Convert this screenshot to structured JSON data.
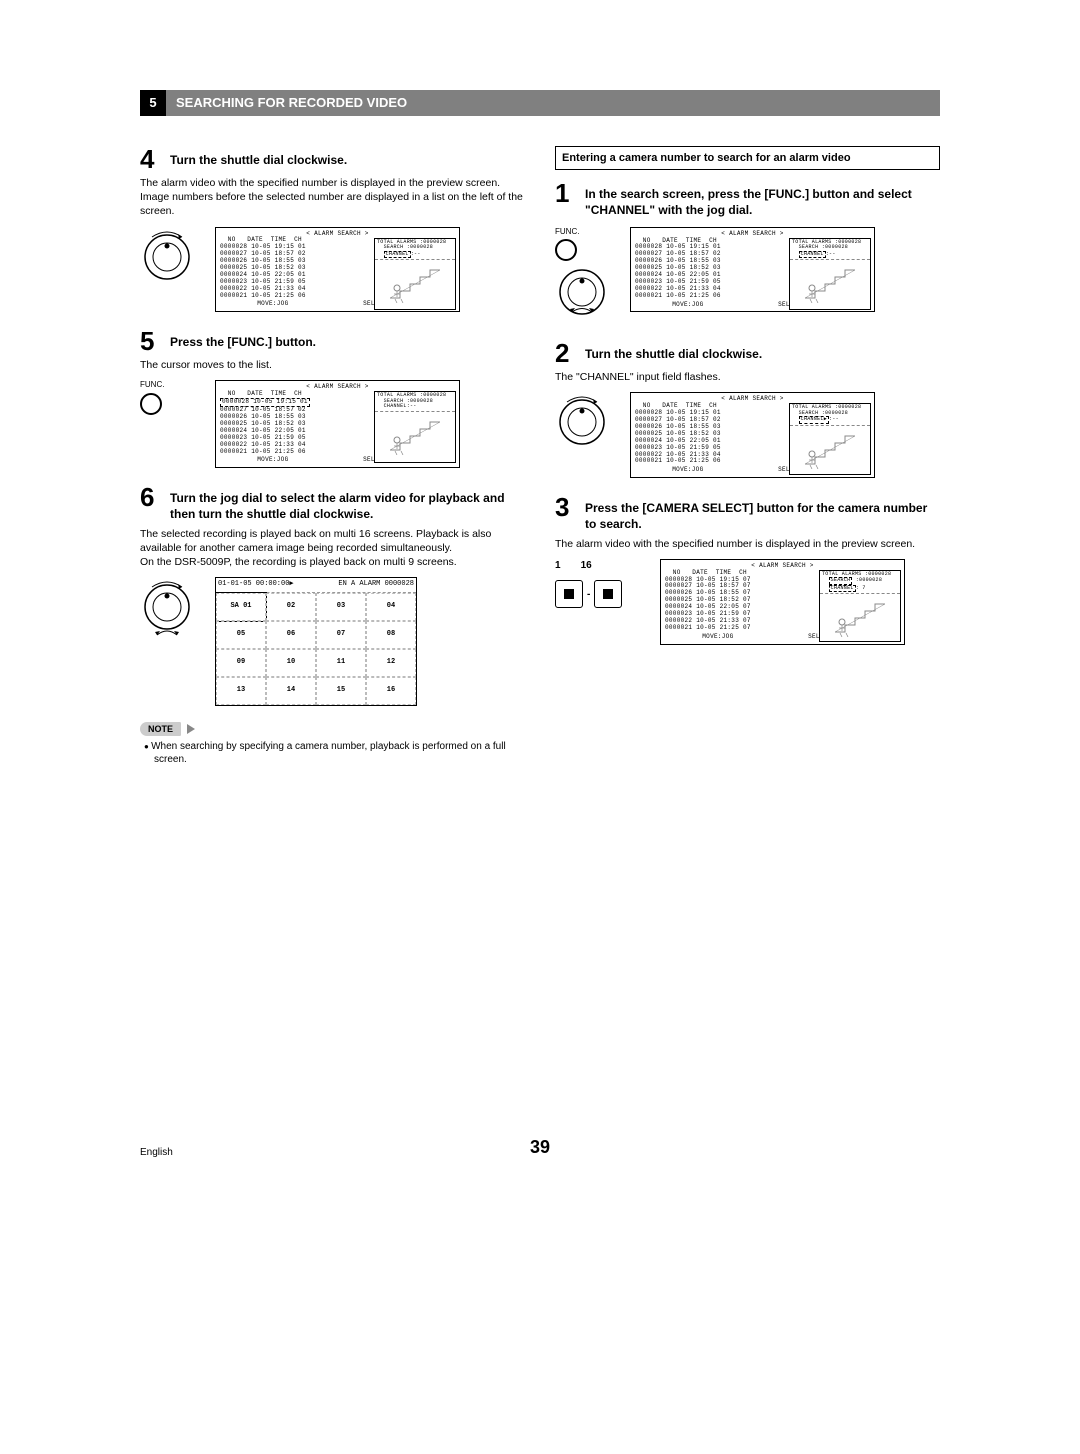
{
  "section": {
    "number": "5",
    "title": "SEARCHING FOR RECORDED VIDEO"
  },
  "left": {
    "step4": {
      "num": "4",
      "title": "Turn the shuttle dial clockwise.",
      "body1": "The alarm video with the specified number is displayed in the preview screen.",
      "body2": "Image numbers before the selected number are displayed in a list on the left of the screen."
    },
    "step5": {
      "num": "5",
      "title": "Press the [FUNC.] button.",
      "body": "The cursor moves to the list.",
      "funcLabel": "FUNC."
    },
    "step6": {
      "num": "6",
      "title": "Turn the jog dial to select the alarm video for playback and then turn the shuttle dial clockwise.",
      "body1": "The selected recording is played back on multi 16 screens. Playback is also available for another camera image being recorded simultaneously.",
      "body2": "On the DSR-5009P, the recording is played back on multi 9 screens."
    },
    "grid": {
      "topLeft": "01-01-05 00:00:00▶",
      "topRight": "EN A ALARM 0000028",
      "sa": "SA",
      "cells": [
        "01",
        "02",
        "03",
        "04",
        "05",
        "06",
        "07",
        "08",
        "09",
        "10",
        "11",
        "12",
        "13",
        "14",
        "15",
        "16"
      ]
    },
    "noteLabel": "NOTE",
    "noteItem": "When searching by specifying a camera number, playback is performed on a full screen."
  },
  "right": {
    "subheading": "Entering a camera number to search for an alarm video",
    "step1": {
      "num": "1",
      "title": "In the search screen, press the [FUNC.] button and select \"CHANNEL\" with the jog dial.",
      "funcLabel": "FUNC."
    },
    "step2": {
      "num": "2",
      "title": "Turn the shuttle dial clockwise.",
      "body": "The \"CHANNEL\" input field flashes."
    },
    "step3": {
      "num": "3",
      "title": "Press the [CAMERA SELECT] button for the camera number to search.",
      "body": "The alarm video with the specified number is displayed in the preview screen."
    },
    "cam": {
      "n1": "1",
      "n16": "16",
      "dash": "-"
    }
  },
  "screens": {
    "title": "< ALARM SEARCH >",
    "hdr": "  NO   DATE  TIME  CH",
    "totalAlarmsLabel": "TOTAL ALARMS",
    "totalAlarmsVal": ":0000028",
    "searchLabel": "SEARCH",
    "channelLabel": "CHANNEL",
    "footerMove": "MOVE:JOG",
    "footerSelect": "SELECT:SHUTTLE",
    "variants": {
      "a": {
        "searchVal": ":0000028",
        "channelVal": ":--",
        "rows": [
          "0000028 10-05 19:15 01",
          "0000027 10-05 18:57 02",
          "0000026 10-05 18:55 03",
          "0000025 10-05 18:52 03",
          "0000024 10-05 22:05 01",
          "0000023 10-05 21:59 05",
          "0000022 10-05 21:33 04",
          "0000021 10-05 21:25 06"
        ],
        "firstRowDashed": false,
        "channelDashed": true
      },
      "b": {
        "searchVal": ":0000028",
        "channelVal": ":--",
        "rows": [
          "0000028 10-05 19:15 01",
          "0000027 10-05 18:57 02",
          "0000026 10-05 18:55 03",
          "0000025 10-05 18:52 03",
          "0000024 10-05 22:05 01",
          "0000023 10-05 21:59 05",
          "0000022 10-05 21:33 04",
          "0000021 10-05 21:25 06"
        ],
        "firstRowDashed": true,
        "channelDashed": false
      },
      "c": {
        "searchVal": ":0000028",
        "channelVal": ":--",
        "rows": [
          "0000028 10-05 19:15 01",
          "0000027 10-05 18:57 02",
          "0000026 10-05 18:55 03",
          "0000025 10-05 18:52 03",
          "0000024 10-05 22:05 01",
          "0000023 10-05 21:59 05",
          "0000022 10-05 21:33 04",
          "0000021 10-05 21:25 06"
        ],
        "firstRowDashed": false,
        "channelDashed": true
      },
      "d": {
        "searchVal": ":0000028",
        "channelVal": ":--",
        "rows": [
          "0000028 10-05 19:15 01",
          "0000027 10-05 18:57 02",
          "0000026 10-05 18:55 03",
          "0000025 10-05 18:52 03",
          "0000024 10-05 22:05 01",
          "0000023 10-05 21:59 05",
          "0000022 10-05 21:33 04",
          "0000021 10-05 21:25 06"
        ],
        "firstRowDashed": false,
        "channelDashed": true,
        "channelArrow": true
      },
      "e": {
        "searchVal": ":0000028",
        "channelVal": ": 7",
        "rows": [
          "0000028 10-05 19:15 07",
          "0000027 10-05 18:57 07",
          "0000026 10-05 18:55 07",
          "0000025 10-05 18:52 07",
          "0000024 10-05 22:05 07",
          "0000023 10-05 21:59 07",
          "0000022 10-05 21:33 07",
          "0000021 10-05 21:25 07"
        ],
        "firstRowDashed": false,
        "channelDashed": true,
        "searchDashed": true
      }
    }
  },
  "footer": {
    "lang": "English",
    "page": "39"
  }
}
